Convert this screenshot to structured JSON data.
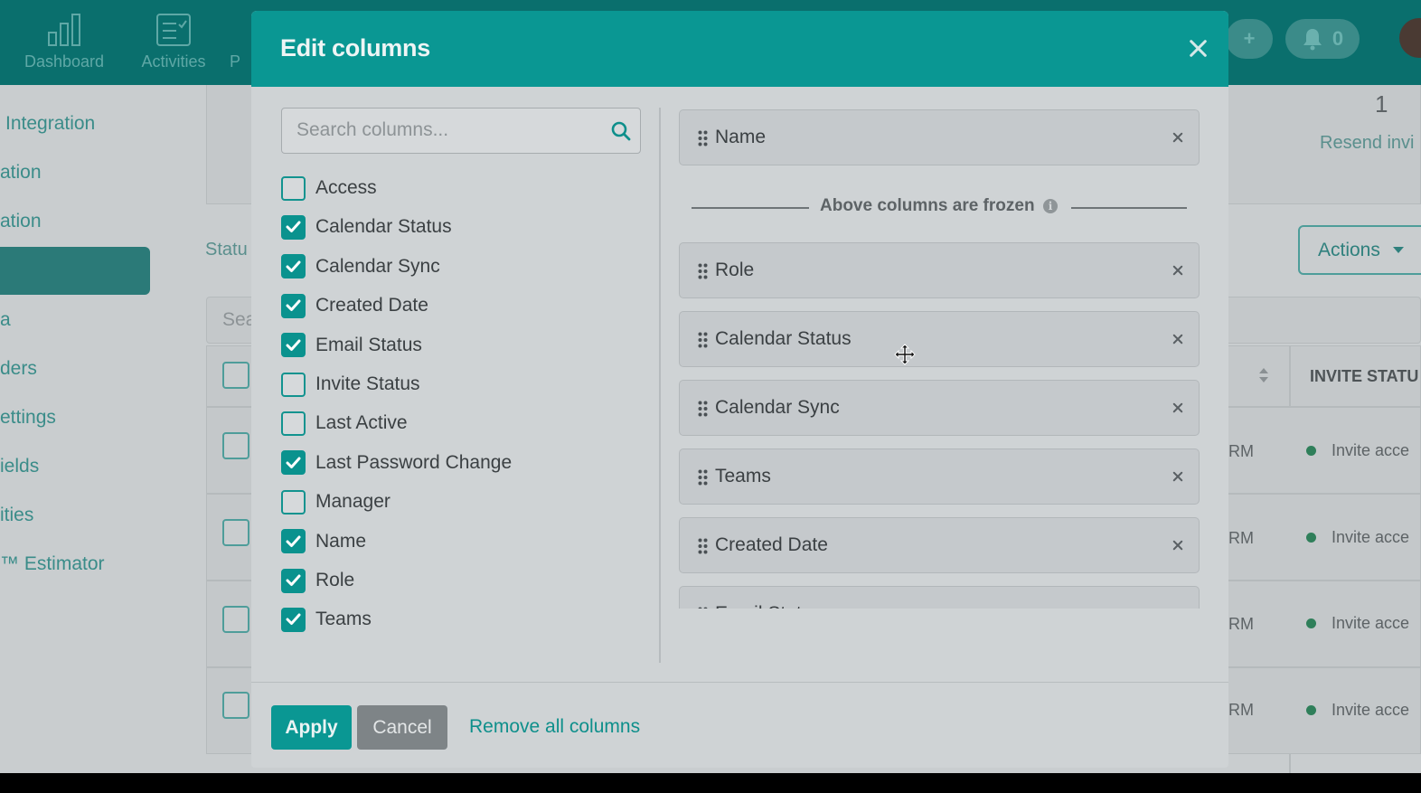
{
  "background": {
    "topnav": [
      {
        "label": "Dashboard"
      },
      {
        "label": "Activities"
      },
      {
        "label": "P"
      }
    ],
    "notification_count": "0",
    "plus_label": "+",
    "sidebar": [
      {
        "label": "Integration"
      },
      {
        "label": "ation"
      },
      {
        "label": "ation"
      },
      {
        "label": "a"
      },
      {
        "label": "ders"
      },
      {
        "label": "ettings"
      },
      {
        "label": "ields"
      },
      {
        "label": "ities"
      },
      {
        "label": "™ Estimator"
      }
    ],
    "status_label": "Statu",
    "search_partial": "Sea",
    "count_value": "1",
    "resend_label": "Resend invi",
    "actions_label": "Actions",
    "col_header_invite": "INVITE STATU",
    "rows": [
      {
        "time_suffix": "RM",
        "invite_status": "Invite acce"
      },
      {
        "time_suffix": "RM",
        "invite_status": "Invite acce"
      },
      {
        "time_suffix": "RM",
        "invite_status": "Invite acce"
      },
      {
        "time_suffix": "RM",
        "invite_status": "Invite acce"
      }
    ]
  },
  "modal": {
    "title": "Edit columns",
    "search_placeholder": "Search columns...",
    "options": [
      {
        "label": "Access",
        "checked": false
      },
      {
        "label": "Calendar Status",
        "checked": true
      },
      {
        "label": "Calendar Sync",
        "checked": true
      },
      {
        "label": "Created Date",
        "checked": true
      },
      {
        "label": "Email Status",
        "checked": true
      },
      {
        "label": "Invite Status",
        "checked": false
      },
      {
        "label": "Last Active",
        "checked": false
      },
      {
        "label": "Last Password Change",
        "checked": true
      },
      {
        "label": "Manager",
        "checked": false
      },
      {
        "label": "Name",
        "checked": true
      },
      {
        "label": "Role",
        "checked": true
      },
      {
        "label": "Teams",
        "checked": true
      }
    ],
    "frozen": [
      {
        "label": "Name"
      }
    ],
    "frozen_divider_text": "Above columns are frozen",
    "selected": [
      {
        "label": "Role"
      },
      {
        "label": "Calendar Status"
      },
      {
        "label": "Calendar Sync"
      },
      {
        "label": "Teams"
      },
      {
        "label": "Created Date"
      },
      {
        "label": "Email Status"
      }
    ],
    "apply_label": "Apply",
    "cancel_label": "Cancel",
    "remove_all_label": "Remove all columns"
  },
  "colors": {
    "header_teal": "#0a9793",
    "accent": "#0e8f8b",
    "overlay_bg": "#c9cdcf"
  }
}
